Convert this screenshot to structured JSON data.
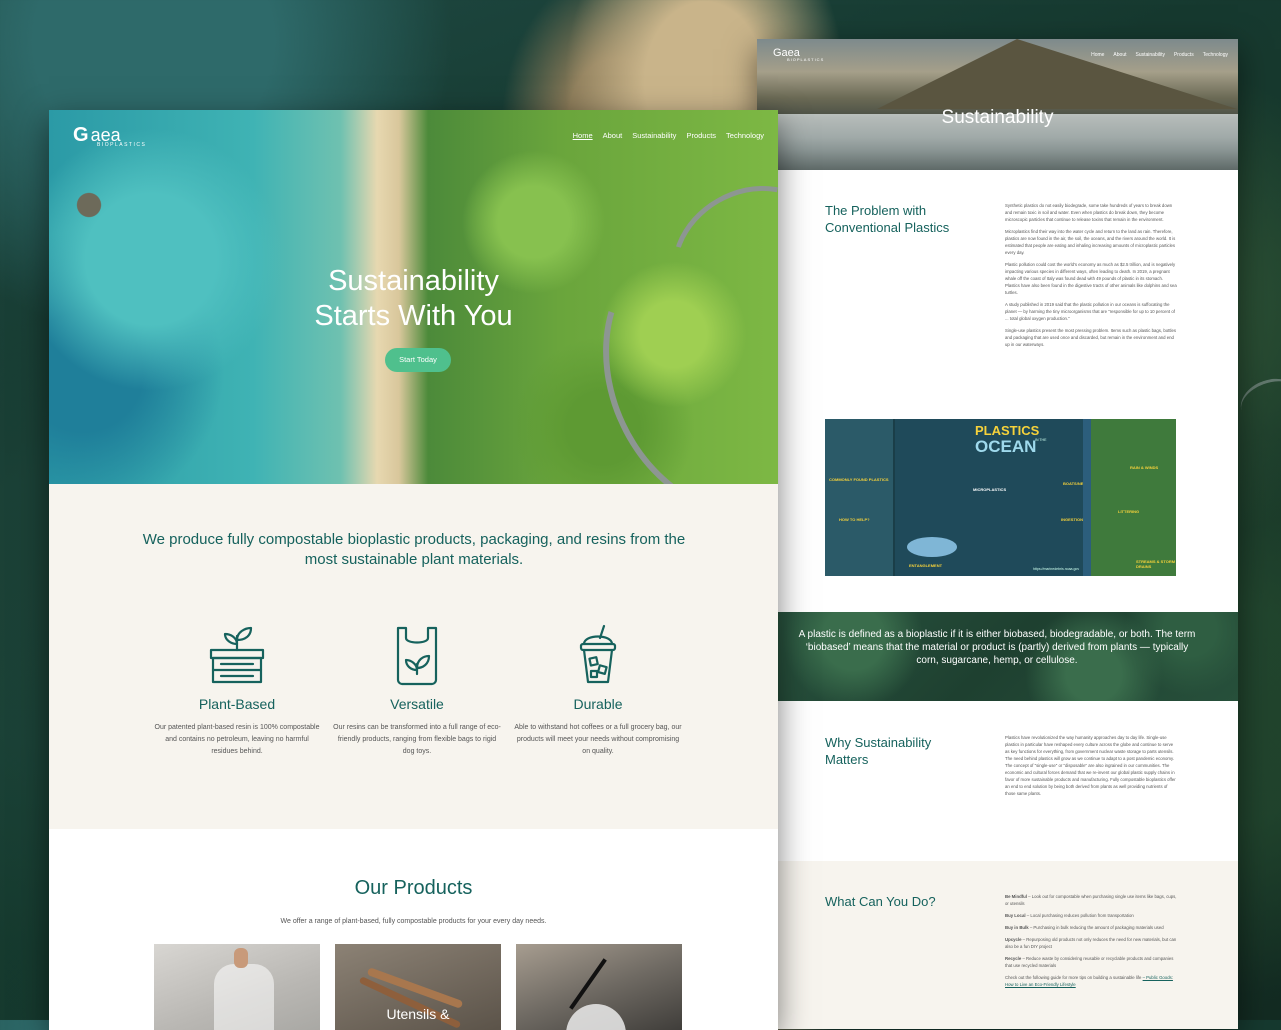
{
  "right_page": {
    "logo": {
      "name": "Gaea",
      "sub": "BIOPLASTICS"
    },
    "nav": [
      "Home",
      "About",
      "Sustainability",
      "Products",
      "Technology"
    ],
    "hero_title": "Sustainability",
    "problem": {
      "heading": "The Problem with Conventional Plastics",
      "paragraphs": [
        "Synthetic plastics do not easily biodegrade, some take hundreds of years to break down and remain toxic in soil and water. Even when plastics do break down, they become microscopic particles that continue to release toxins that remain in the environment.",
        "Microplastics find their way into the water cycle and return to the land as rain. Therefore, plastics are now found in the air, the soil, the oceans, and the rivers around the world. It is estimated that people are eating and inhaling increasing amounts of microplastic particles every day.",
        "Plastic pollution could cost the world's economy as much as $2.5 trillion, and is negatively impacting various species in different ways, often leading to death. In 2019, a pregnant whale off the coast of Italy was found dead with 49 pounds of plastic in its stomach. Plastics have also been found in the digestive tracts of other animals like dolphins and sea turtles.",
        "A study published in 2019 said that the plastic pollution in our oceans is suffocating the planet — by harming the tiny microorganisms that are \"responsible for up to 10 percent of ... total global oxygen production.\"",
        "Single-use plastics present the most pressing problem. Items such as plastic bags, bottles and packaging that are used once and discarded, but remain in the environment and end up in our waterways."
      ]
    },
    "infographic": {
      "title_top": "PLASTICS",
      "title_in": "IN THE",
      "title_bottom": "OCEAN",
      "labels": [
        "COMMONLY FOUND PLASTICS",
        "HOW TO HELP?",
        "MICROPLASTICS",
        "BOATS/NETS",
        "INGESTION",
        "ENTANGLEMENT",
        "RAIN & WINDS",
        "STREAMS & STORM DRAINS",
        "LITTERING"
      ],
      "url": "https://marinedebris.noaa.gov"
    },
    "quote": "A plastic is defined as a bioplastic if it is either biobased, biodegradable, or both. The term ‘biobased’ means that the material or product is (partly) derived from plants — typically corn, sugarcane, hemp, or cellulose.",
    "why": {
      "heading": "Why Sustainability Matters",
      "text": "Plastics have revolutionized the way humanity approaches day to day life. Single-use plastics in particular have reshaped every culture across the globe and continue to serve as key functions for everything, from government nuclear waste storage to parts utensils. The need behind plastics will grow as we continue to adapt to a post pandemic economy. The concept of \"single-use\" or \"disposable\" are also ingrained in our communities. The economic and cultural forces demand that we re-invent our global plastic supply chains in favor of more sustainable products and manufacturing. Fully compostable bioplastics offer an end to end solution by being both derived from plants as well providing nutrients of those same plants."
    },
    "what": {
      "heading": "What Can You Do?",
      "items": [
        {
          "bold": "Be Mindful",
          "text": " – Look out for compostable when purchasing single use items like bags, cups, or utensils"
        },
        {
          "bold": "Buy Local",
          "text": " – Local purchasing reduces pollution from transportation"
        },
        {
          "bold": "Buy in Bulk",
          "text": " – Purchasing in bulk reducing the amount of packaging materials used"
        },
        {
          "bold": "Upcycle",
          "text": " – Repurposing old products not only reduces the need for new materials, but can also be a fun DIY project"
        },
        {
          "bold": "Recycle",
          "text": " – Reduce waste by considering reusable or recyclable products and companies that use recycled materials"
        }
      ],
      "guide_text": "Check out the following guide for more tips on building a sustainable life",
      "guide_link": "– Public Goods: How to Live an Eco-Friendly Lifestyle"
    }
  },
  "left_page": {
    "logo": {
      "mark": "G",
      "name": "aea",
      "sub": "BIOPLASTICS"
    },
    "nav": [
      "Home",
      "About",
      "Sustainability",
      "Products",
      "Technology"
    ],
    "hero_title_line1": "Sustainability",
    "hero_title_line2": "Starts With You",
    "cta": "Start Today",
    "tagline": "We produce fully compostable bioplastic products, packaging, and resins from the most sustainable plant materials.",
    "features": [
      {
        "title": "Plant-Based",
        "desc": "Our patented plant-based resin is 100% compostable and contains no petroleum, leaving no harmful residues behind.",
        "icon": "crate-sprout-icon"
      },
      {
        "title": "Versatile",
        "desc": "Our resins can be transformed into a full range of eco-friendly products, ranging from flexible bags to rigid dog toys.",
        "icon": "bag-leaf-icon"
      },
      {
        "title": "Durable",
        "desc": "Able to withstand hot coffees or a full grocery bag, our products will meet your needs without compromising on quality.",
        "icon": "cup-straw-icon"
      }
    ],
    "products_heading": "Our Products",
    "products_desc": "We offer a range of plant-based, fully compostable products for your every day needs.",
    "cards": [
      "",
      "Utensils &",
      ""
    ]
  },
  "colors": {
    "primary": "#16625d",
    "accent": "#4fc08d",
    "cream": "#f7f4ee"
  }
}
